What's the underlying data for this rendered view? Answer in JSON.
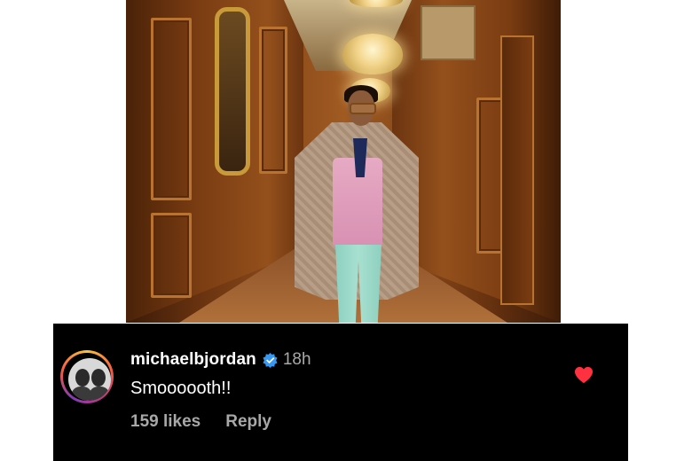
{
  "photo": {
    "icon": "post-photo"
  },
  "comment": {
    "username": "michaelbjordan",
    "verified_icon": "verified-badge-icon",
    "time_ago": "18h",
    "text": "Smoooooth!!",
    "likes": "159 likes",
    "reply_label": "Reply",
    "liked": true,
    "heart_color": "#ff3040",
    "verified_color": "#3897f0"
  }
}
